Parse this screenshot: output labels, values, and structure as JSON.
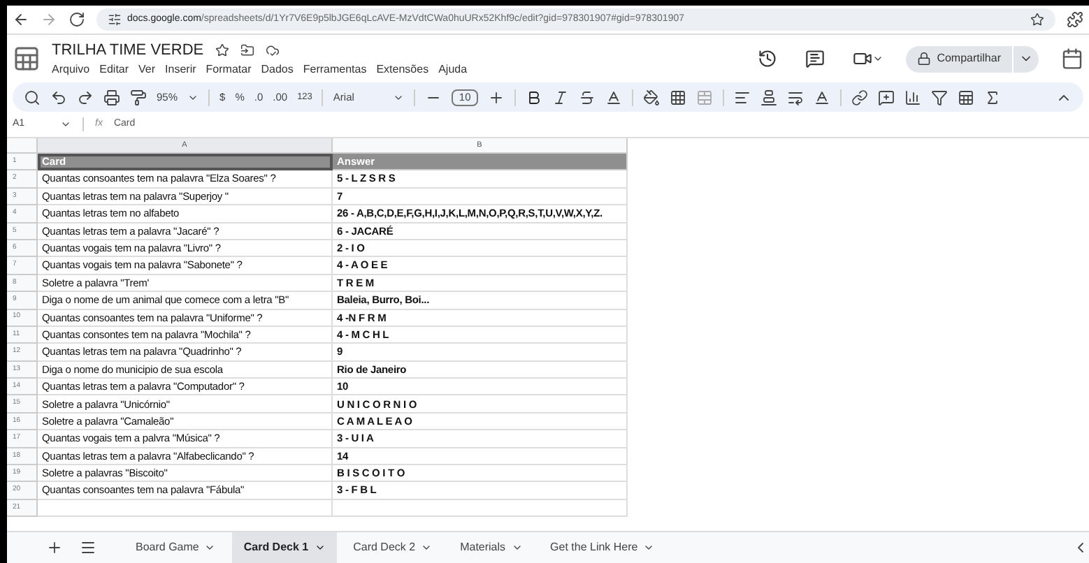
{
  "browser": {
    "url_host": "docs.google.com",
    "url_path": "/spreadsheets/d/1Yr7V6E9p5lbJGE6qLcAVE-MzVdtCWa0huURx52Khf9c/edit?gid=978301907#gid=978301907"
  },
  "document": {
    "title": "TRILHA TIME VERDE",
    "menus": [
      "Arquivo",
      "Editar",
      "Ver",
      "Inserir",
      "Formatar",
      "Dados",
      "Ferramentas",
      "Extensões",
      "Ajuda"
    ],
    "share_button": "Compartilhar"
  },
  "toolbar": {
    "zoom": "95%",
    "currency": "$",
    "percent": "%",
    "decrease_decimals": ".0",
    "increase_decimals": ".00",
    "number_format": "123",
    "font": "Arial",
    "font_size": "10"
  },
  "formula_bar": {
    "cell": "A1",
    "fx_label": "fx",
    "content": "Card"
  },
  "sheet": {
    "columns": [
      "A",
      "B"
    ],
    "rows": [
      {
        "number": "1",
        "kind": "header",
        "cells": [
          "Card",
          "Answer"
        ]
      },
      {
        "number": "2",
        "kind": "data",
        "cells": [
          "Quantas consoantes tem na palavra \"Elza Soares\" ?",
          "5 - L Z S R S"
        ]
      },
      {
        "number": "3",
        "kind": "data",
        "cells": [
          "Quantas letras tem na palavra \"Superjoy \"",
          "7"
        ]
      },
      {
        "number": "4",
        "kind": "data",
        "cells": [
          "Quantas letras tem no alfabeto",
          "26 - A,B,C,D,E,F,G,H,I,J,K,L,M,N,O,P,Q,R,S,T,U,V,W,X,Y,Z."
        ]
      },
      {
        "number": "5",
        "kind": "data",
        "cells": [
          "Quantas letras tem a palavra \"Jacaré\" ?",
          "6 - JACARÉ"
        ]
      },
      {
        "number": "6",
        "kind": "data",
        "cells": [
          "Quantas vogais tem na palavra \"Livro\" ?",
          "2 - I O"
        ]
      },
      {
        "number": "7",
        "kind": "data",
        "cells": [
          "Quantas vogais tem na palavra \"Sabonete\" ?",
          "4 - A O E E"
        ]
      },
      {
        "number": "8",
        "kind": "data",
        "cells": [
          "Soletre a palavra \"Trem'",
          "T R E M"
        ]
      },
      {
        "number": "9",
        "kind": "data",
        "cells": [
          "Diga o nome de um animal que comece com a letra \"B\"",
          "Baleia, Burro, Boi..."
        ]
      },
      {
        "number": "10",
        "kind": "data",
        "cells": [
          "Quantas consoantes tem na palavra \"Uniforme\" ?",
          "4 -N F R M"
        ]
      },
      {
        "number": "11",
        "kind": "data",
        "cells": [
          "Quantas consontes tem na palavra \"Mochila\" ?",
          "4 - M C H L"
        ]
      },
      {
        "number": "12",
        "kind": "data",
        "cells": [
          "Quantas letras tem na palavra \"Quadrinho\" ?",
          "9"
        ]
      },
      {
        "number": "13",
        "kind": "data",
        "cells": [
          "Diga o nome do municipio de sua escola",
          "Rio de Janeiro"
        ]
      },
      {
        "number": "14",
        "kind": "data",
        "cells": [
          "Quantas letras tem a palavra \"Computador\" ?",
          "10"
        ]
      },
      {
        "number": "15",
        "kind": "data",
        "cells": [
          "Soletre a palavra \"Unicórnio\"",
          "U N I C O R N I O"
        ]
      },
      {
        "number": "16",
        "kind": "data",
        "cells": [
          "Soletre a palavra \"Camaleão\"",
          "C A M A L E A O"
        ]
      },
      {
        "number": "17",
        "kind": "data",
        "cells": [
          "Quantas vogais tem a palvra \"Música\" ?",
          "3 - U I A"
        ]
      },
      {
        "number": "18",
        "kind": "data",
        "cells": [
          "Quantas letras tem a palavra \"Alfabeclicando\" ?",
          "14"
        ]
      },
      {
        "number": "19",
        "kind": "data",
        "cells": [
          "Soletre a palavras \"Biscoito\"",
          "B I S C O I T O"
        ]
      },
      {
        "number": "20",
        "kind": "data",
        "cells": [
          "Quantas consoantes tem na palavra \"Fábula\"",
          "3 - F B L"
        ]
      },
      {
        "number": "21",
        "kind": "empty"
      }
    ]
  },
  "sheet_tabs": [
    {
      "label": "Board Game",
      "selected": false
    },
    {
      "label": "Card Deck 1",
      "selected": true
    },
    {
      "label": "Card Deck 2",
      "selected": false
    },
    {
      "label": "Materials",
      "selected": false
    },
    {
      "label": "Get the Link Here",
      "selected": false
    }
  ]
}
